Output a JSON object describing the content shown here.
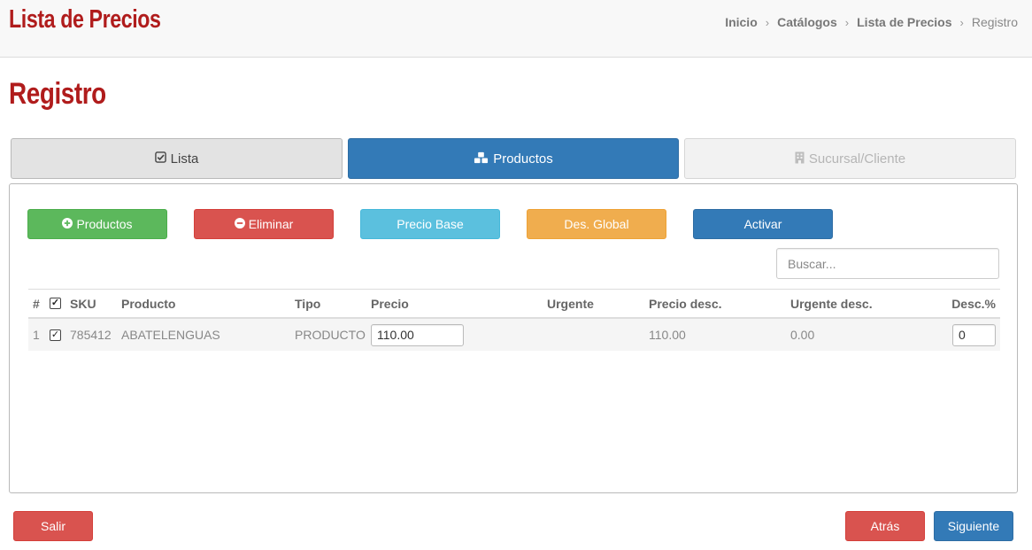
{
  "header": {
    "app_title": "Lista de Precios",
    "breadcrumb": [
      "Inicio",
      "Catálogos",
      "Lista de Precios",
      "Registro"
    ],
    "separator": "›"
  },
  "page": {
    "title": "Registro"
  },
  "wizard_tabs": [
    {
      "label": "Lista",
      "icon": "check-square-icon",
      "state": "completed"
    },
    {
      "label": "Productos",
      "icon": "cubes-icon",
      "state": "active"
    },
    {
      "label": "Sucursal/Cliente",
      "icon": "building-icon",
      "state": "disabled"
    }
  ],
  "toolbar": {
    "add_products": "Productos",
    "delete": "Eliminar",
    "base_price": "Precio Base",
    "global_discount": "Des. Global",
    "activate": "Activar"
  },
  "search": {
    "placeholder": "Buscar...",
    "value": ""
  },
  "table": {
    "headers": {
      "index": "#",
      "sku": "SKU",
      "product": "Producto",
      "type": "Tipo",
      "price": "Precio",
      "urgent": "Urgente",
      "discount_price": "Precio desc.",
      "urgent_discount": "Urgente desc.",
      "discount_pct": "Desc.%"
    },
    "rows": [
      {
        "index": "1",
        "checked": true,
        "sku": "785412",
        "product": "ABATELENGUAS",
        "type": "PRODUCTO",
        "price": "110.00",
        "urgent": "",
        "discount_price": "110.00",
        "urgent_discount": "0.00",
        "discount_pct": "0"
      }
    ]
  },
  "footer": {
    "exit": "Salir",
    "back": "Atrás",
    "next": "Siguiente"
  },
  "colors": {
    "brand_red": "#b01c1c",
    "primary": "#337ab7",
    "success": "#5cb85c",
    "danger": "#d9534f",
    "info": "#5bc0de",
    "warning": "#f0ad4e"
  }
}
